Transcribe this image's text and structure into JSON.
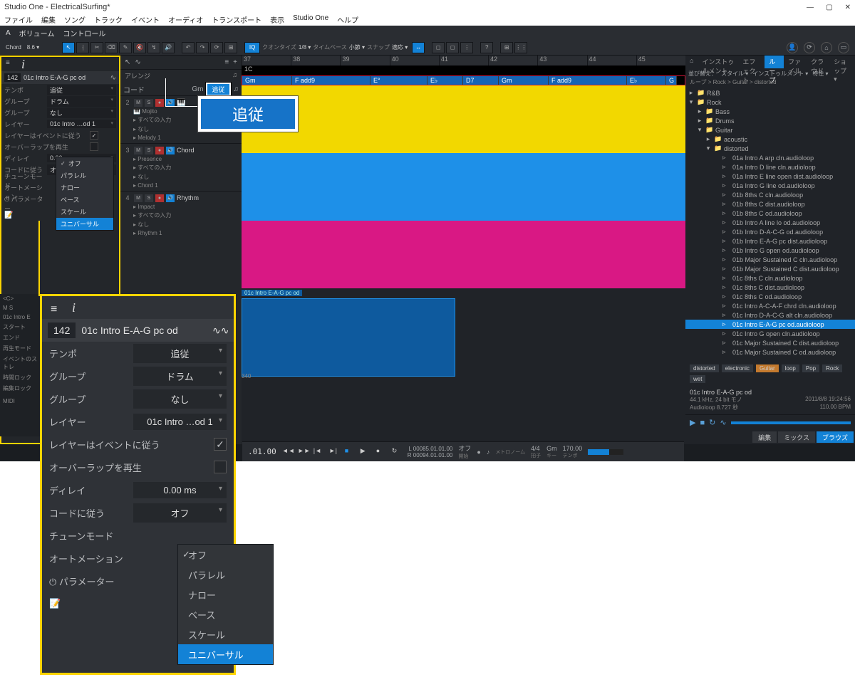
{
  "title": "Studio One - ElectricalSurfing*",
  "menus": [
    "ファイル",
    "編集",
    "ソング",
    "トラック",
    "イベント",
    "オーディオ",
    "トランスポート",
    "表示",
    "Studio One",
    "ヘルプ"
  ],
  "volbar": {
    "a": "A",
    "vol": "ボリューム",
    "ctrl": "コントロール",
    "chord": "Chord",
    "pct": "8.6 ▾"
  },
  "toolbar": {
    "quantize_lbl": "クオンタイズ",
    "quantize_val": "1/8 ▾",
    "timebase_lbl": "タイムベース",
    "timebase_val": "小節 ▾",
    "snap_lbl": "スナップ",
    "snap_val": "適応 ▾",
    "iq": "IQ"
  },
  "inspector": {
    "bpm": "142",
    "name": "01c Intro E-A-G pc od",
    "rows": {
      "tempo": {
        "lbl": "テンポ",
        "val": "追従"
      },
      "group1": {
        "lbl": "グループ",
        "val": "ドラム"
      },
      "group2": {
        "lbl": "グループ",
        "val": "なし"
      },
      "layer": {
        "lbl": "レイヤー",
        "val": "01c Intro …od 1"
      },
      "layerfollow": {
        "lbl": "レイヤーはイベントに従う",
        "chk": "✓"
      },
      "overlap": {
        "lbl": "オーバーラップを再生",
        "chk": ""
      },
      "delay": {
        "lbl": "ディレイ",
        "val": "0.00 ms"
      },
      "chord": {
        "lbl": "コードに従う",
        "val": "オフ"
      },
      "tune": {
        "lbl": "チューンモード",
        "val": ""
      },
      "auto": {
        "lbl": "オートメーション"
      },
      "param": {
        "lbl": "⏻ パラメーター"
      }
    },
    "dropdown": [
      "オフ",
      "パラレル",
      "ナロー",
      "ベース",
      "スケール",
      "ユニバーサル"
    ],
    "dropdown_checked": "オフ",
    "dropdown_hi": "ユニバーサル"
  },
  "tracks": {
    "arr_lbl": "アレンジ",
    "chord_lbl": "コード",
    "chord_key": "Gm",
    "chord_btn": "追従",
    "t2": {
      "num": "2",
      "name": "Mojito",
      "rows": [
        "▸ すべての入力",
        "▸ なし",
        "▸ Melody 1"
      ]
    },
    "t3": {
      "num": "3",
      "name": "Chord",
      "rows": [
        "▸ Presence",
        "▸ すべての入力",
        "▸ なし",
        "▸ Chord 1"
      ]
    },
    "t4": {
      "num": "4",
      "name": "Rhythm",
      "rows": [
        "▸ Impact",
        "▸ すべての入力",
        "▸ なし",
        "▸ Rhythm 1"
      ]
    }
  },
  "ruler": [
    "37",
    "38",
    "39",
    "40",
    "41",
    "42",
    "43",
    "44",
    "45"
  ],
  "chordbar_marker": "1C",
  "chords": [
    "Gm",
    "F add9",
    "E°",
    "E♭",
    "D7",
    "Gm",
    "F add9",
    "E♭",
    "G"
  ],
  "clip_label": "01c Intro E-A-G pc od",
  "lane_time_marker": "340",
  "browser": {
    "tabs": [
      "インストゥルメント",
      "エフェクト",
      "ループ",
      "ファイル",
      "クラウド",
      "ショップ ▾"
    ],
    "active_tab": "ループ",
    "sort_lbl": "並び替え：",
    "sort_style": "スタイル ▾",
    "sort_instr": "インストゥルメント ▾",
    "sort_spec": "特性 ▾",
    "crumb": "ループ > Rock > Guitar > distorted",
    "tree": [
      {
        "t": "folder",
        "ind": 0,
        "arr": "▸",
        "name": "R&B"
      },
      {
        "t": "folder",
        "ind": 0,
        "arr": "▾",
        "name": "Rock"
      },
      {
        "t": "folder",
        "ind": 1,
        "arr": "▸",
        "name": "Bass"
      },
      {
        "t": "folder",
        "ind": 1,
        "arr": "▸",
        "name": "Drums"
      },
      {
        "t": "folder",
        "ind": 1,
        "arr": "▾",
        "name": "Guitar"
      },
      {
        "t": "folder",
        "ind": 2,
        "arr": "▸",
        "name": "acoustic"
      },
      {
        "t": "folder",
        "ind": 2,
        "arr": "▾",
        "name": "distorted"
      },
      {
        "t": "file",
        "ind": 3,
        "name": "01a Intro A arp cln.audioloop"
      },
      {
        "t": "file",
        "ind": 3,
        "name": "01a Intro D line cln.audioloop"
      },
      {
        "t": "file",
        "ind": 3,
        "name": "01a Intro E line open dist.audioloop"
      },
      {
        "t": "file",
        "ind": 3,
        "name": "01a Intro G line od.audioloop"
      },
      {
        "t": "file",
        "ind": 3,
        "name": "01b 8ths C cln.audioloop"
      },
      {
        "t": "file",
        "ind": 3,
        "name": "01b 8ths C dist.audioloop"
      },
      {
        "t": "file",
        "ind": 3,
        "name": "01b 8ths C od.audioloop"
      },
      {
        "t": "file",
        "ind": 3,
        "name": "01b Intro A line lo od.audioloop"
      },
      {
        "t": "file",
        "ind": 3,
        "name": "01b Intro D-A-C-G od.audioloop"
      },
      {
        "t": "file",
        "ind": 3,
        "name": "01b Intro E-A-G pc dist.audioloop"
      },
      {
        "t": "file",
        "ind": 3,
        "name": "01b Intro G open od.audioloop"
      },
      {
        "t": "file",
        "ind": 3,
        "name": "01b Major Sustained C cln.audioloop"
      },
      {
        "t": "file",
        "ind": 3,
        "name": "01b Major Sustained C dist.audioloop"
      },
      {
        "t": "file",
        "ind": 3,
        "name": "01c 8ths C cln.audioloop"
      },
      {
        "t": "file",
        "ind": 3,
        "name": "01c 8ths C dist.audioloop"
      },
      {
        "t": "file",
        "ind": 3,
        "name": "01c 8ths C od.audioloop"
      },
      {
        "t": "file",
        "ind": 3,
        "name": "01c Intro A-C-A-F chrd cln.audioloop"
      },
      {
        "t": "file",
        "ind": 3,
        "name": "01c Intro D-A-C-G alt cln.audioloop"
      },
      {
        "t": "file",
        "ind": 3,
        "name": "01c Intro E-A-G pc od.audioloop",
        "sel": true
      },
      {
        "t": "file",
        "ind": 3,
        "name": "01c Intro G open cln.audioloop"
      },
      {
        "t": "file",
        "ind": 3,
        "name": "01c Major Sustained C dist.audioloop"
      },
      {
        "t": "file",
        "ind": 3,
        "name": "01c Major Sustained C od.audioloop"
      }
    ],
    "tags": [
      "distorted",
      "electronic",
      "Guitar",
      "loop",
      "Pop",
      "Rock",
      "wet"
    ],
    "info": {
      "title": "01c Intro E-A-G pc od",
      "format": "44.1 kHz, 24 bit モノ",
      "date": "2011/8/8 19:24:56",
      "type": "Audioloop",
      "len": "8.727 秒",
      "bpm": "110.00 BPM"
    },
    "bottom": [
      "編集",
      "ミックス",
      "ブラウズ"
    ]
  },
  "transport": {
    "pos": ".01.00",
    "t1": "00085.01.01.00",
    "t2": "00094.01.01.00",
    "off": "オフ",
    "bars": "開始",
    "rec": "●",
    "metro": "メトロノーム",
    "sig": "4/4",
    "sig2": "拍子",
    "key": "Gm",
    "key2": "キー",
    "bpm": "170.00",
    "bpm2": "テンポ"
  },
  "callout": "追従",
  "zoom": {
    "bpm": "142",
    "name": "01c Intro E-A-G pc od",
    "rows": {
      "tempo": {
        "lbl": "テンポ",
        "val": "追従"
      },
      "group1": {
        "lbl": "グループ",
        "val": "ドラム"
      },
      "group2": {
        "lbl": "グループ",
        "val": "なし"
      },
      "layer": {
        "lbl": "レイヤー",
        "val": "01c Intro …od 1"
      },
      "layerfollow": {
        "lbl": "レイヤーはイベントに従う",
        "chk": "✓"
      },
      "overlap": {
        "lbl": "オーバーラップを再生",
        "chk": ""
      },
      "delay": {
        "lbl": "ディレイ",
        "val": "0.00 ms"
      },
      "chord": {
        "lbl": "コードに従う",
        "val": "オフ"
      },
      "tune": {
        "lbl": "チューンモード"
      },
      "auto": {
        "lbl": "オートメーション"
      },
      "param": {
        "lbl": "⏻ パラメーター"
      },
      "edit": {
        "lbl": "📝"
      }
    }
  },
  "ll": [
    "<C>",
    "M  S",
    "01c Intro E",
    "スタート",
    "エンド",
    "再生モード",
    "イベントのストレ",
    "時間ロック",
    "編集ロック",
    "",
    "MIDI"
  ]
}
